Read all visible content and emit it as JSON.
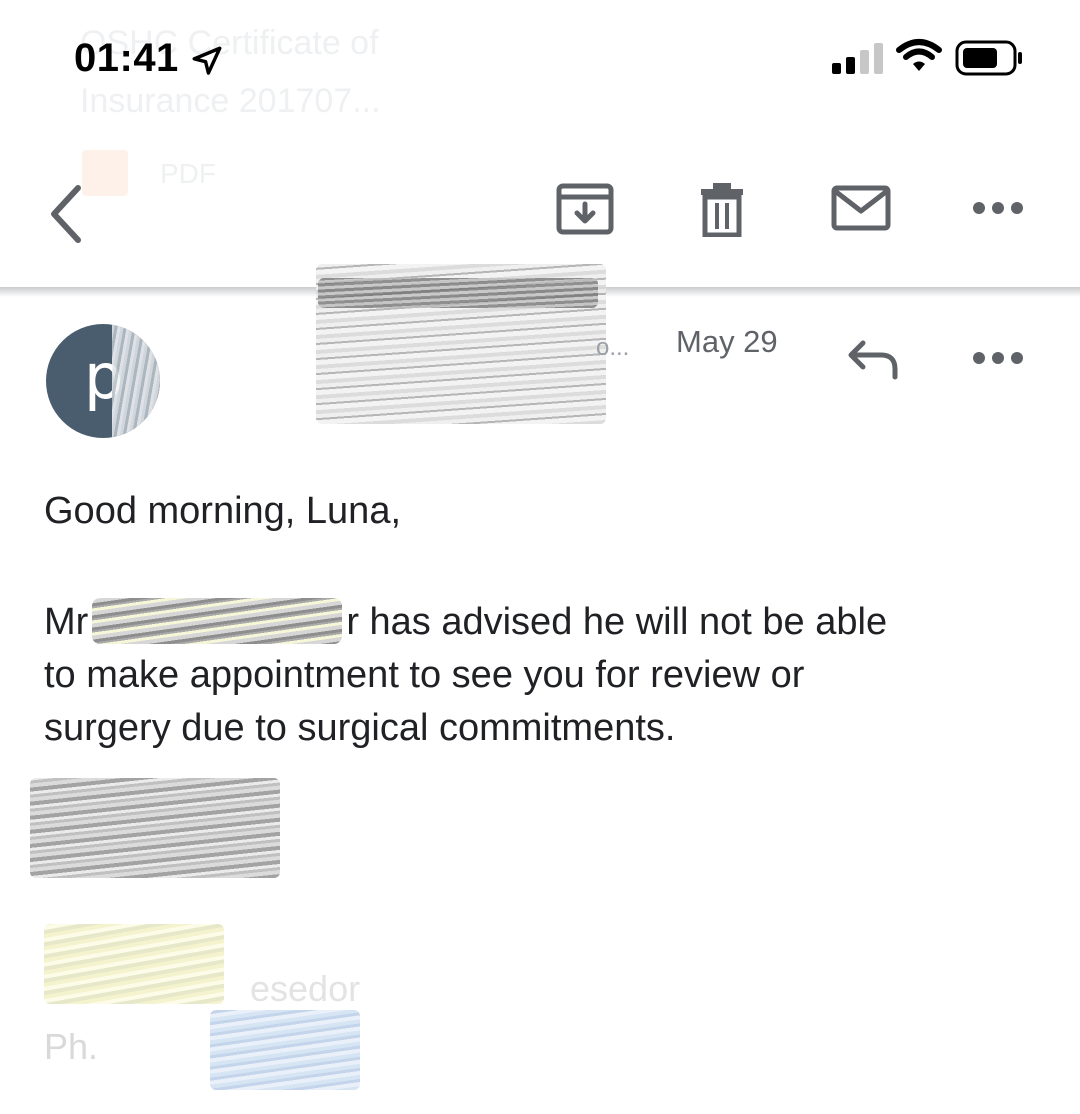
{
  "status_bar": {
    "time": "01:41",
    "icons": [
      "location-arrow-icon",
      "cellular-signal-icon",
      "wifi-icon",
      "battery-icon"
    ]
  },
  "background_ghost": {
    "line1": "OSHC Certificate of",
    "line2": "Insurance 201707...",
    "attachment_label": "PDF"
  },
  "toolbar": {
    "icons": [
      "back-chevron-icon",
      "archive-icon",
      "trash-icon",
      "mail-icon",
      "more-horizontal-icon"
    ]
  },
  "message": {
    "avatar_letter": "p",
    "sender_truncated": "o...",
    "date": "May 29",
    "actions": [
      "reply-icon",
      "more-horizontal-icon"
    ]
  },
  "body": {
    "greeting": "Good morning, Luna,",
    "line1_start": "Mr",
    "line1_end": "r has advised he will not be able",
    "line2": "to make appointment to see you for review or",
    "line3": "surgery due to surgical commitments.",
    "signature_fragment": "esedor",
    "phone_fragment": "Ph."
  },
  "colors": {
    "avatar_bg": "#4a5d6e",
    "icon_gray": "#5f6368",
    "text": "#202124",
    "secondary_text": "#5f6368"
  }
}
